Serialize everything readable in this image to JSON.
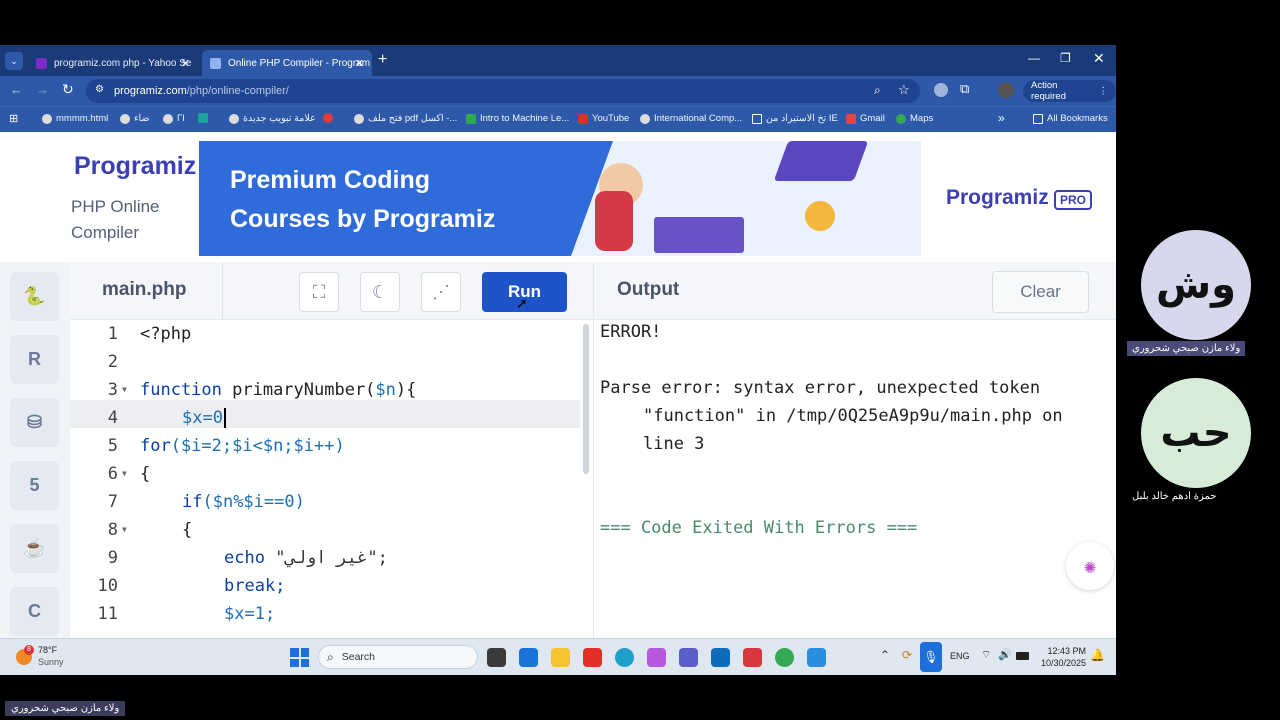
{
  "browser": {
    "tabs": [
      {
        "title": "programiz.com php - Yahoo Se",
        "favicon_color": "#7b2cc6"
      },
      {
        "title": "Online PHP Compiler - Program",
        "favicon_color": "#2e58a8"
      }
    ],
    "url_host": "programiz.com",
    "url_path": "/php/online-compiler/",
    "action_required": "Action required",
    "bookmarks": [
      "mmmm.html",
      "ضاء",
      "ΓΙ",
      "علامة تبويب جديدة",
      "فتح ملف pdf اكسل -...",
      "Intro to Machine Le...",
      "YouTube",
      "International Comp...",
      "تخ الاستيراد من IE",
      "Gmail",
      "Maps"
    ],
    "all_bookmarks": "All Bookmarks"
  },
  "header": {
    "logo": "Programiz",
    "subtitle": "PHP Online Compiler",
    "banner_text": "Premium Coding Courses by Programiz",
    "pro_logo": "Programiz",
    "pro_badge": "PRO"
  },
  "editor": {
    "filename": "main.php",
    "run_label": "Run",
    "lines": [
      {
        "n": "1",
        "fold": false
      },
      {
        "n": "2",
        "fold": false
      },
      {
        "n": "3",
        "fold": true
      },
      {
        "n": "4",
        "fold": false
      },
      {
        "n": "5",
        "fold": false
      },
      {
        "n": "6",
        "fold": true
      },
      {
        "n": "7",
        "fold": false
      },
      {
        "n": "8",
        "fold": true
      },
      {
        "n": "9",
        "fold": false
      },
      {
        "n": "10",
        "fold": false
      },
      {
        "n": "11",
        "fold": false
      }
    ],
    "code": {
      "l1": "<?php",
      "l3_kw": "function",
      "l3_rest": " primaryNumber(",
      "l3_var": "$n",
      "l3_end": "){",
      "l4": "$x=0",
      "l5_kw": "for",
      "l5_rest": "($i=2;$i<$n;$i++)",
      "l6": "{",
      "l7_kw": "if",
      "l7_rest": "($n%$i==0)",
      "l8": "{",
      "l9_kw": "echo",
      "l9_str": " \"غير اولي\";",
      "l10": "break;",
      "l11": "$x=1;"
    }
  },
  "output": {
    "title": "Output",
    "clear_label": "Clear",
    "line1": "ERROR!",
    "line2": "Parse error: syntax error, unexpected token",
    "line3": "\"function\" in /tmp/0Q25eA9p9u/main.php on",
    "line4": "line 3",
    "line5": "=== Code Exited With Errors ==="
  },
  "taskbar": {
    "weather_temp": "78°F",
    "weather_desc": "Sunny",
    "weather_badge": "8",
    "search_placeholder": "Search",
    "lang": "ENG",
    "time": "12:43 PM",
    "date": "10/30/2025"
  },
  "participants": [
    {
      "initials": "وش",
      "name": "ولاء مازن صبحي شحروري",
      "color": "#d8d8ec"
    },
    {
      "initials": "حب",
      "name": "حمزة ادهم خالد بلبل",
      "color": "#d6ecd8"
    }
  ],
  "self_label": "ولاء مازن صبحي شحروري"
}
